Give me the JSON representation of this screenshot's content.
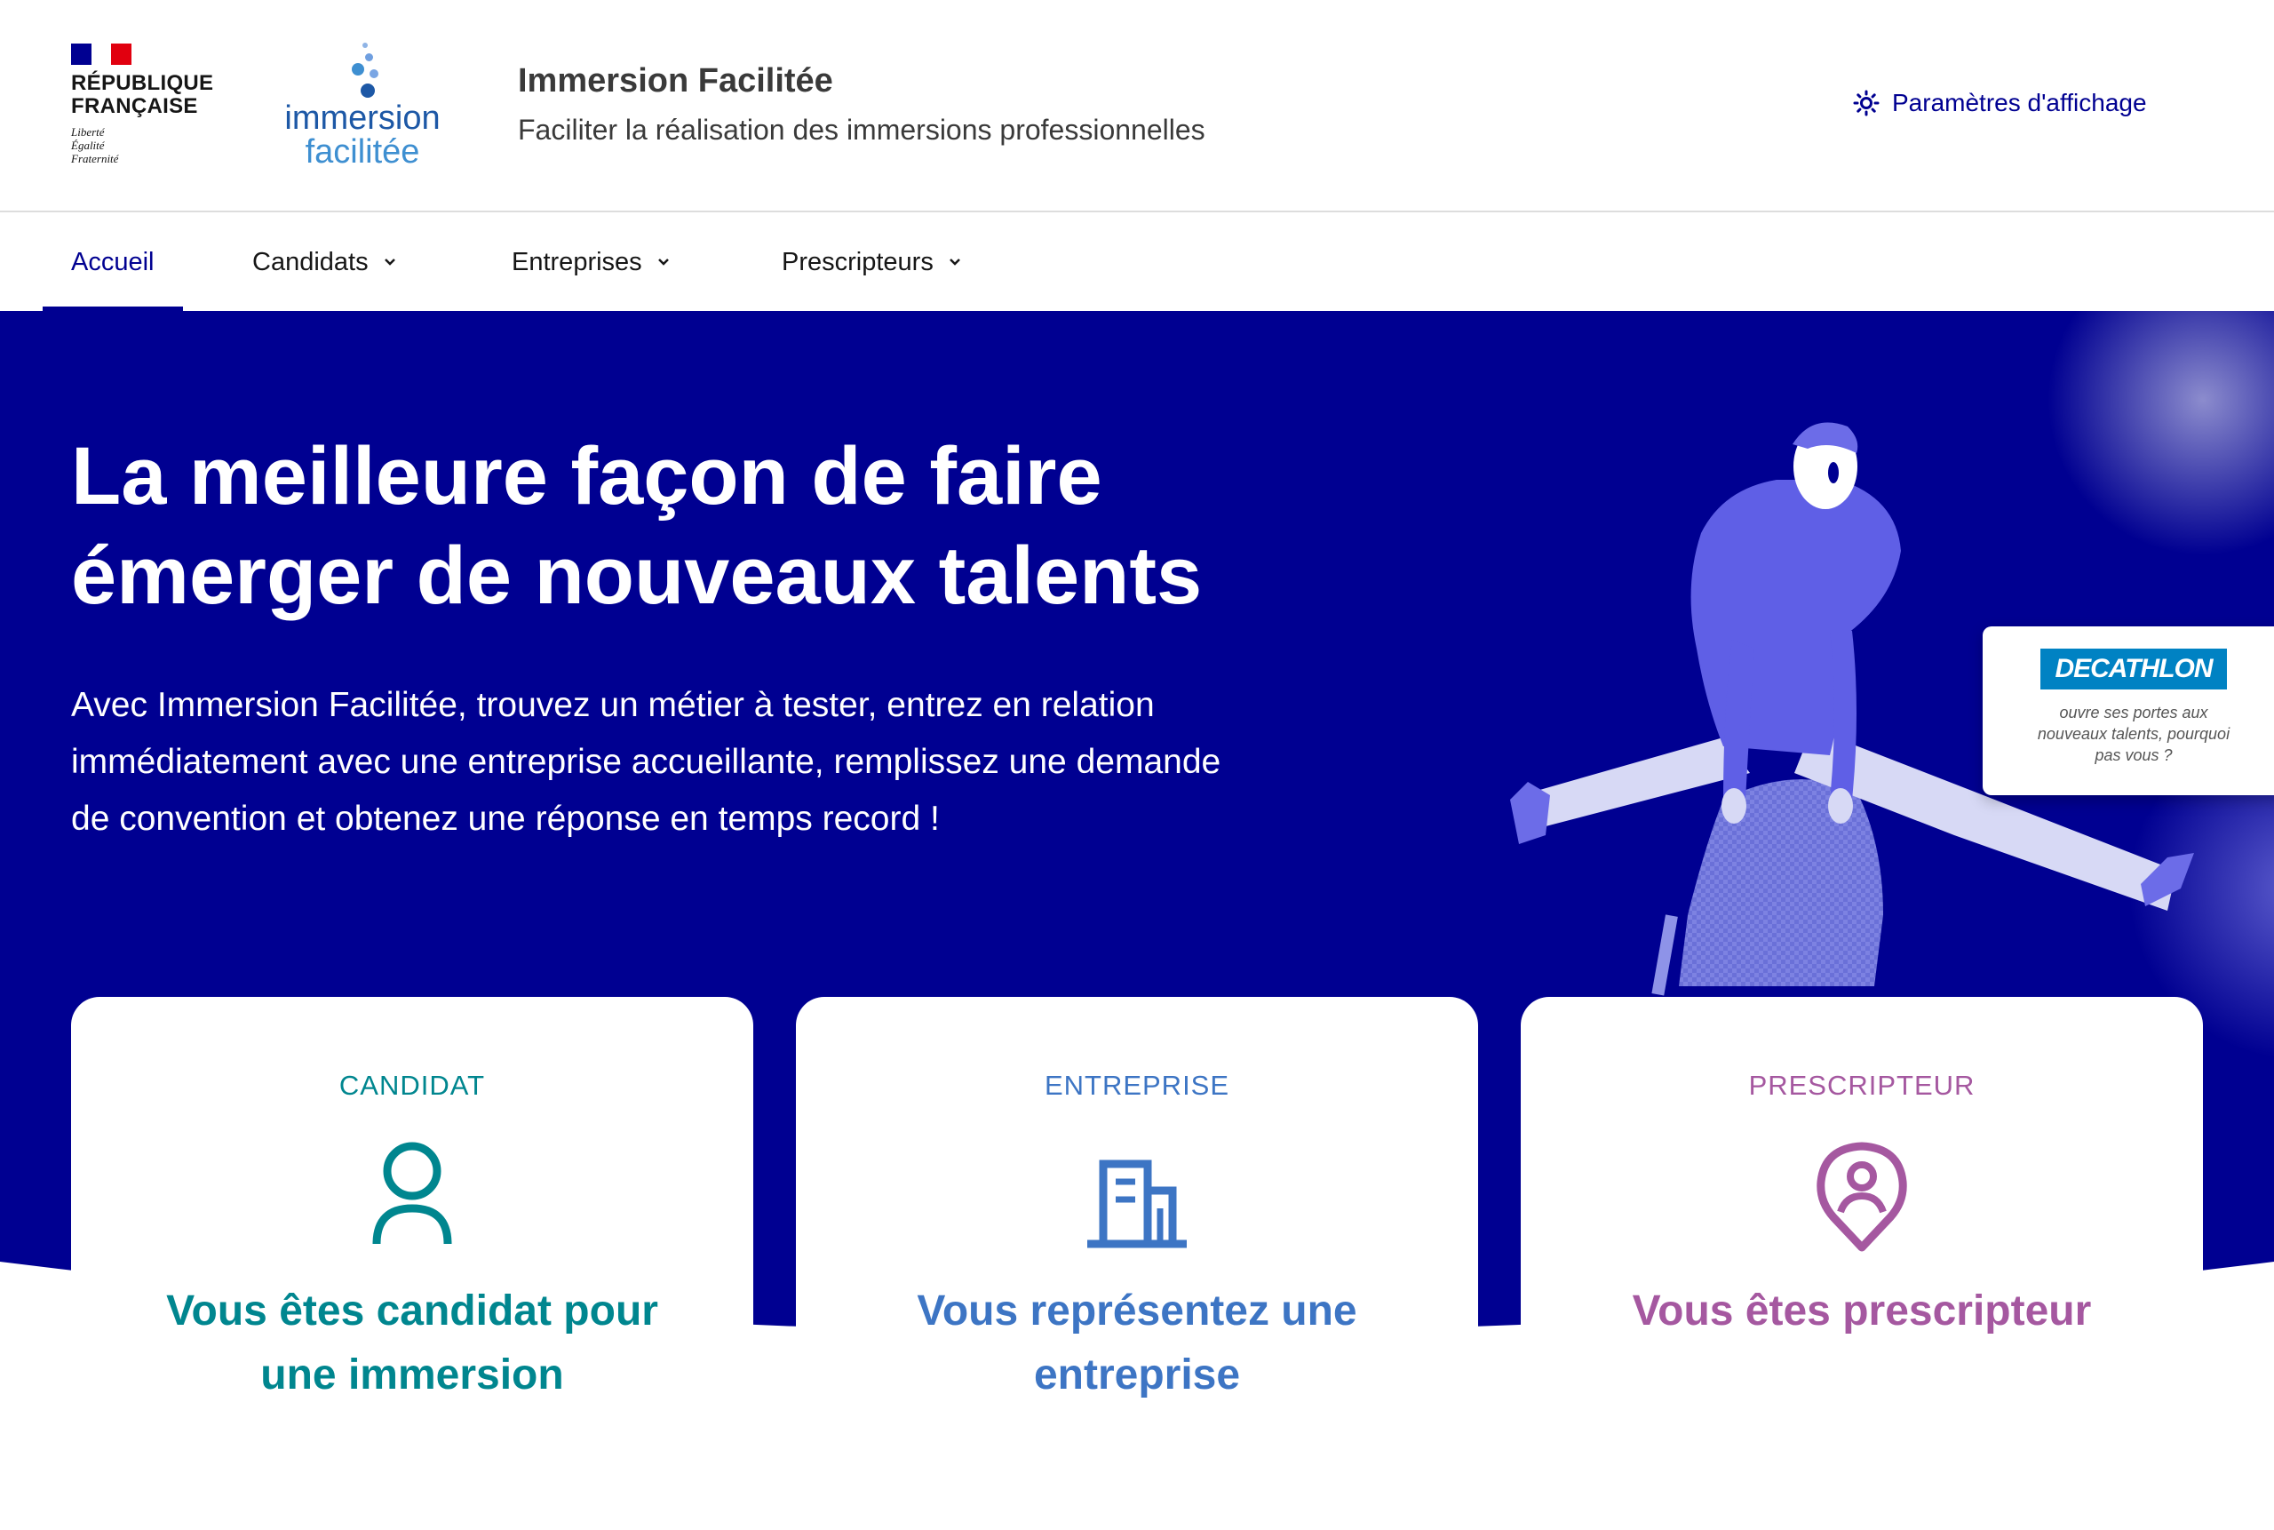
{
  "header": {
    "republique_lines": [
      "RÉPUBLIQUE",
      "FRANÇAISE"
    ],
    "motto_lines": [
      "Liberté",
      "Égalité",
      "Fraternité"
    ],
    "logo_word1": "immersion",
    "logo_word2": "facilitée",
    "site_title": "Immersion Facilitée",
    "site_tagline": "Faciliter la réalisation des immersions professionnelles",
    "display_settings_label": "Paramètres d'affichage"
  },
  "nav": {
    "items": [
      {
        "label": "Accueil",
        "active": true,
        "has_dropdown": false
      },
      {
        "label": "Candidats",
        "active": false,
        "has_dropdown": true
      },
      {
        "label": "Entreprises",
        "active": false,
        "has_dropdown": true
      },
      {
        "label": "Prescripteurs",
        "active": false,
        "has_dropdown": true
      }
    ]
  },
  "hero": {
    "title_line1": "La meilleure façon de faire",
    "title_line2": "émerger de nouveaux talents",
    "text_line1": "Avec Immersion Facilitée, trouvez un métier à tester, entrez en relation",
    "text_line2": "immédiatement avec une entreprise accueillante, remplissez une demande",
    "text_line3": "de convention et obtenez une réponse en temps record !",
    "promo": {
      "brand": "DECATHLON",
      "text_line1": "ouvre ses portes aux",
      "text_line2": "nouveaux talents, pourquoi",
      "text_line3": "pas vous ?"
    }
  },
  "cards": [
    {
      "kind": "CANDIDAT",
      "title_line1": "Vous êtes candidat pour",
      "title_line2": "une immersion",
      "icon": "user-icon",
      "color": "#00868f"
    },
    {
      "kind": "ENTREPRISE",
      "title_line1": "Vous représentez une",
      "title_line2": "entreprise",
      "icon": "building-icon",
      "color": "#3d75c4"
    },
    {
      "kind": "PRESCRIPTEUR",
      "title_line1": "Vous êtes prescripteur",
      "title_line2": "",
      "icon": "map-pin-user-icon",
      "color": "#a558a0"
    }
  ],
  "colors": {
    "primary": "#000091",
    "hero_bg": "#000091",
    "candidat": "#00868f",
    "entreprise": "#3d75c4",
    "prescripteur": "#a558a0"
  }
}
